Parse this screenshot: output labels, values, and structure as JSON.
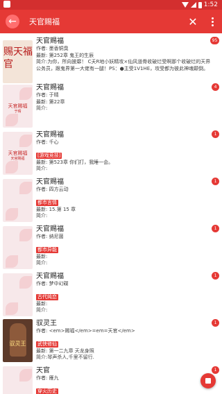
{
  "status_bar": {
    "time": "1:52"
  },
  "toolbar": {
    "search_query": "天官赐福",
    "clear_icon": "close-icon",
    "more_icon": "more-vert-icon"
  },
  "results": [
    {
      "title": "天官赐福",
      "author": "作者: 墨香铜臭",
      "tag": "",
      "latest": "最新: 第252章 鬼王的生辰",
      "intro": "简介:为你，所向披靡！ C夭R地小妖精攻×仙风道骨收破烂受啊那个收破烂的天界公务员，跟鬼界第一大佬有一腿！PS：●主受1V1HE，攻受都为彼此神魂颠倒。●攻...",
      "count": "95"
    },
    {
      "title": "天官赐福",
      "author": "作者: 于晴",
      "tag": "",
      "latest": "最新: 第22章",
      "intro": "简介:",
      "count": "4"
    },
    {
      "title": "天官赐福",
      "author": "作者: 千心",
      "tag": "[游戏竞技]",
      "latest": "最新: 第523章 你们打，我睡一会。",
      "intro": "简介:",
      "count": "1"
    },
    {
      "title": "天官赐福",
      "author": "作者: 四方云动",
      "tag": "都市言情",
      "latest": "最新: 15.第 15 章",
      "intro": "简介:",
      "count": "1"
    },
    {
      "title": "天官赐福",
      "author": "作者: 纳尼菌",
      "tag": "都市异能",
      "latest": "最新:",
      "intro": "简介:",
      "count": "1"
    },
    {
      "title": "天官赐福",
      "author": "作者: 梦中幻碟",
      "tag": "古代纯恋",
      "latest": "最新:",
      "intro": "简介:",
      "count": "1"
    },
    {
      "title": "驭灵王",
      "author": "作者: <em>赐福</em>=em=天官</em>",
      "tag": "武侠修仙",
      "latest": "最新: 第一二九章 天龙身照",
      "intro": "简介:琴声杀人,千里不留行.",
      "count": "1"
    },
    {
      "title": "天官",
      "author": "作者: 雁九",
      "tag": "穿火历史",
      "latest": "最新: 第一百七十五章 余音（大结局）",
      "intro": "",
      "count": "1"
    }
  ],
  "covers": [
    {
      "style": "big",
      "text": "赐天福官",
      "sub": ""
    },
    {
      "style": "pink",
      "text": "天官赐福",
      "sub": "于晴"
    },
    {
      "style": "pink",
      "text": "天官赐福",
      "sub": "天官赐福"
    },
    {
      "style": "pink",
      "text": "",
      "sub": ""
    },
    {
      "style": "pink",
      "text": "",
      "sub": ""
    },
    {
      "style": "pink",
      "text": "",
      "sub": ""
    },
    {
      "style": "dark",
      "text": "驭灵王",
      "sub": ""
    },
    {
      "style": "pink",
      "text": "",
      "sub": ""
    }
  ],
  "fab": {
    "icon": "stop-icon"
  },
  "colors": {
    "primary": "#e53935",
    "status_bar": "#d32f2f",
    "badge": "#e53935"
  }
}
